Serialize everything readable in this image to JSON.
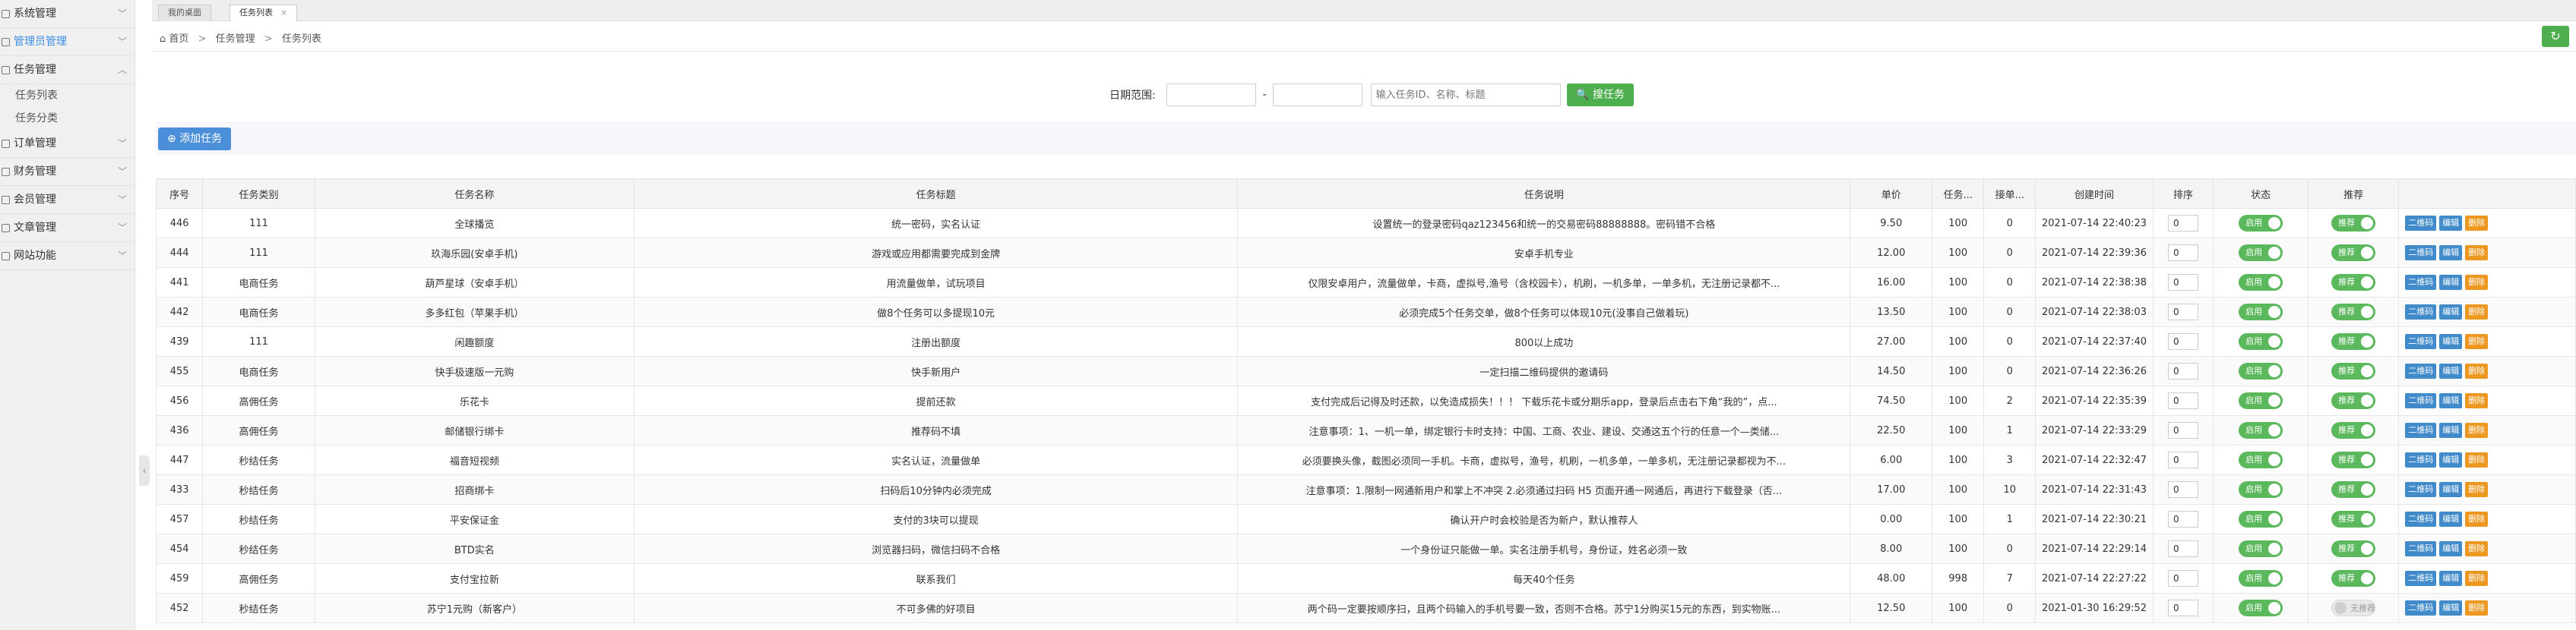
{
  "sidebar": {
    "menus": [
      {
        "label": "系统管理",
        "icon": "gear-icon",
        "active": false
      },
      {
        "label": "管理员管理",
        "icon": "user-icon",
        "active": true
      },
      {
        "label": "任务管理",
        "icon": "list-icon",
        "active": false,
        "expanded": true,
        "children": [
          "任务列表",
          "任务分类"
        ]
      },
      {
        "label": "订单管理",
        "icon": "order-icon",
        "active": false
      },
      {
        "label": "财务管理",
        "icon": "finance-icon",
        "active": false
      },
      {
        "label": "会员管理",
        "icon": "member-icon",
        "active": false
      },
      {
        "label": "文章管理",
        "icon": "article-icon",
        "active": false
      },
      {
        "label": "网站功能",
        "icon": "site-icon",
        "active": false
      }
    ]
  },
  "tabs": [
    {
      "label": "我的桌面",
      "active": false
    },
    {
      "label": "任务列表",
      "active": true,
      "close": "×"
    }
  ],
  "breadcrumb": {
    "home": "首页",
    "level1": "任务管理",
    "level2": "任务列表",
    "separator": ">"
  },
  "search": {
    "date_label": "日期范围:",
    "range_separator": "-",
    "keyword_placeholder": "输入任务ID、名称、标题",
    "button_label": "搜任务"
  },
  "toolbar": {
    "add_label": "添加任务"
  },
  "table": {
    "headers": [
      "序号",
      "任务类别",
      "任务名称",
      "任务标题",
      "任务说明",
      "单价",
      "任务...",
      "接单...",
      "创建时间",
      "排序",
      "状态",
      "推荐",
      ""
    ],
    "rows": [
      {
        "id": "446",
        "category": "111",
        "name": "全球播览",
        "title": "统一密码，实名认证",
        "desc": "设置统一的登录密码qaz123456和统一的交易密码88888888。密码错不合格",
        "price": "9.50",
        "total": "100",
        "taken": "0",
        "created": "2021-07-14 22:40:23",
        "sort": "0",
        "status": "启用",
        "recommend": "推荐",
        "recommend_on": true
      },
      {
        "id": "444",
        "category": "111",
        "name": "玖海乐园(安卓手机)",
        "title": "游戏或应用都需要完成到金牌",
        "desc": "安卓手机专业",
        "price": "12.00",
        "total": "100",
        "taken": "0",
        "created": "2021-07-14 22:39:36",
        "sort": "0",
        "status": "启用",
        "recommend": "推荐",
        "recommend_on": true
      },
      {
        "id": "441",
        "category": "电商任务",
        "name": "葫芦星球（安卓手机）",
        "title": "用流量做单，试玩项目",
        "desc": "仅限安卓用户，流量做单，卡商，虚拟号,渔号（含校园卡），机刷，一机多单，一单多机，无注册记录都不...",
        "price": "16.00",
        "total": "100",
        "taken": "0",
        "created": "2021-07-14 22:38:38",
        "sort": "0",
        "status": "启用",
        "recommend": "推荐",
        "recommend_on": true
      },
      {
        "id": "442",
        "category": "电商任务",
        "name": "多多红包（苹果手机）",
        "title": "做8个任务可以多提现10元",
        "desc": "必须完成5个任务交单，做8个任务可以体现10元(没事自己做着玩)",
        "price": "13.50",
        "total": "100",
        "taken": "0",
        "created": "2021-07-14 22:38:03",
        "sort": "0",
        "status": "启用",
        "recommend": "推荐",
        "recommend_on": true
      },
      {
        "id": "439",
        "category": "111",
        "name": "闲趣额度",
        "title": "注册出额度",
        "desc": "800以上成功",
        "price": "27.00",
        "total": "100",
        "taken": "0",
        "created": "2021-07-14 22:37:40",
        "sort": "0",
        "status": "启用",
        "recommend": "推荐",
        "recommend_on": true
      },
      {
        "id": "455",
        "category": "电商任务",
        "name": "快手极速版一元购",
        "title": "快手新用户",
        "desc": "一定扫描二维码提供的邀请码",
        "price": "14.50",
        "total": "100",
        "taken": "0",
        "created": "2021-07-14 22:36:26",
        "sort": "0",
        "status": "启用",
        "recommend": "推荐",
        "recommend_on": true
      },
      {
        "id": "456",
        "category": "高佣任务",
        "name": "乐花卡",
        "title": "提前还款",
        "desc": "支付完成后记得及时还款，以免造成损失！！！ 下载乐花卡或分期乐app，登录后点击右下角“我的”，点...",
        "price": "74.50",
        "total": "100",
        "taken": "2",
        "created": "2021-07-14 22:35:39",
        "sort": "0",
        "status": "启用",
        "recommend": "推荐",
        "recommend_on": true
      },
      {
        "id": "436",
        "category": "高佣任务",
        "name": "邮储银行绑卡",
        "title": "推荐码不填",
        "desc": "注意事项：1、一机一单，绑定银行卡时支持：中国、工商、农业、建设、交通这五个行的任意一个—类储...",
        "price": "22.50",
        "total": "100",
        "taken": "1",
        "created": "2021-07-14 22:33:29",
        "sort": "0",
        "status": "启用",
        "recommend": "推荐",
        "recommend_on": true
      },
      {
        "id": "447",
        "category": "秒结任务",
        "name": "福音短视频",
        "title": "实名认证，流量做单",
        "desc": "必须要换头像，截图必须同一手机。卡商，虚拟号，渔号，机刷，一机多单，一单多机，无注册记录都视为不...",
        "price": "6.00",
        "total": "100",
        "taken": "3",
        "created": "2021-07-14 22:32:47",
        "sort": "0",
        "status": "启用",
        "recommend": "推荐",
        "recommend_on": true
      },
      {
        "id": "433",
        "category": "秒结任务",
        "name": "招商绑卡",
        "title": "扫码后10分钟内必须完成",
        "desc": "注意事项：1.限制一网通新用户和掌上不冲突 2.必须通过扫码 H5 页面开通一网通后，再进行下载登录（否...",
        "price": "17.00",
        "total": "100",
        "taken": "10",
        "created": "2021-07-14 22:31:43",
        "sort": "0",
        "status": "启用",
        "recommend": "推荐",
        "recommend_on": true
      },
      {
        "id": "457",
        "category": "秒结任务",
        "name": "平安保证金",
        "title": "支付的3块可以提现",
        "desc": "确认开户时会校验是否为新户，默认推荐人",
        "price": "0.00",
        "total": "100",
        "taken": "1",
        "created": "2021-07-14 22:30:21",
        "sort": "0",
        "status": "启用",
        "recommend": "推荐",
        "recommend_on": true
      },
      {
        "id": "454",
        "category": "秒结任务",
        "name": "BTD实名",
        "title": "浏览器扫码，微信扫码不合格",
        "desc": "一个身份证只能做一单。实名注册手机号，身份证，姓名必须一致",
        "price": "8.00",
        "total": "100",
        "taken": "0",
        "created": "2021-07-14 22:29:14",
        "sort": "0",
        "status": "启用",
        "recommend": "推荐",
        "recommend_on": true
      },
      {
        "id": "459",
        "category": "高佣任务",
        "name": "支付宝拉新",
        "title": "联系我们",
        "desc": "每天40个任务",
        "price": "48.00",
        "total": "998",
        "taken": "7",
        "created": "2021-07-14 22:27:22",
        "sort": "0",
        "status": "启用",
        "recommend": "推荐",
        "recommend_on": true
      },
      {
        "id": "452",
        "category": "秒结任务",
        "name": "苏宁1元购（新客户）",
        "title": "不可多佛的好项目",
        "desc": "两个码一定要按顺序扫，且两个码输入的手机号要一致，否则不合格。苏宁1分购买15元的东西，到实物账...",
        "price": "12.50",
        "total": "100",
        "taken": "0",
        "created": "2021-01-30 16:29:52",
        "sort": "0",
        "status": "启用",
        "recommend": "无推荐",
        "recommend_on": false
      }
    ],
    "actions": [
      "二维码",
      "编辑",
      "删除"
    ]
  },
  "colors": {
    "accent": "#4cae4c",
    "primary": "#428bca",
    "danger": "#ec971f",
    "link_active": "#3b8ee8"
  }
}
